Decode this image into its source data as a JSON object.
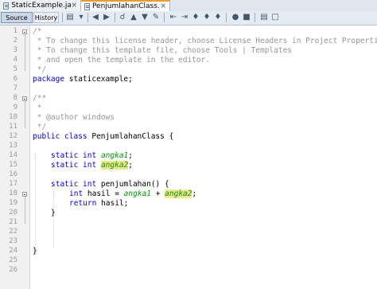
{
  "tabs": [
    {
      "label": "StaticExample.java",
      "close": "×"
    },
    {
      "label": "PenjumlahanClass.java",
      "close": "×"
    }
  ],
  "toolbar": {
    "source_label": "Source",
    "history_label": "History"
  },
  "line_numbers": [
    "1",
    "2",
    "3",
    "4",
    "5",
    "6",
    "7",
    "8",
    "9",
    "10",
    "11",
    "12",
    "13",
    "14",
    "15",
    "16",
    "17",
    "18",
    "19",
    "20",
    "21",
    "22",
    "23",
    "24",
    "25",
    "26"
  ],
  "code": {
    "l1": "/*",
    "l2": " * To change this license header, choose License Headers in Project Properti",
    "l3": " * To change this template file, choose Tools | Templates",
    "l4": " * and open the template in the editor.",
    "l5": " */",
    "l6_kw": "package",
    "l6_rest": " staticexample;",
    "l8": "/**",
    "l9": " *",
    "l10": " * @author windows",
    "l11": " */",
    "l12_kw": "public class",
    "l12_rest": " PenjumlahanClass {",
    "l14_kw": "static int",
    "l14_sp": " ",
    "l14_field": "angka1",
    "l14_end": ";",
    "l15_kw": "static int",
    "l15_sp": " ",
    "l15_field": "angka2",
    "l15_end": ";",
    "l17_kw": "static int",
    "l17_rest": " penjumlahan() {",
    "l18_kw": "int",
    "l18_mid": " hasil = ",
    "l18_f1": "angka1",
    "l18_plus": " + ",
    "l18_f2": "angka2",
    "l18_end": ";",
    "l19_kw": "return",
    "l19_rest": " hasil;",
    "l20": "}",
    "l24": "}"
  }
}
